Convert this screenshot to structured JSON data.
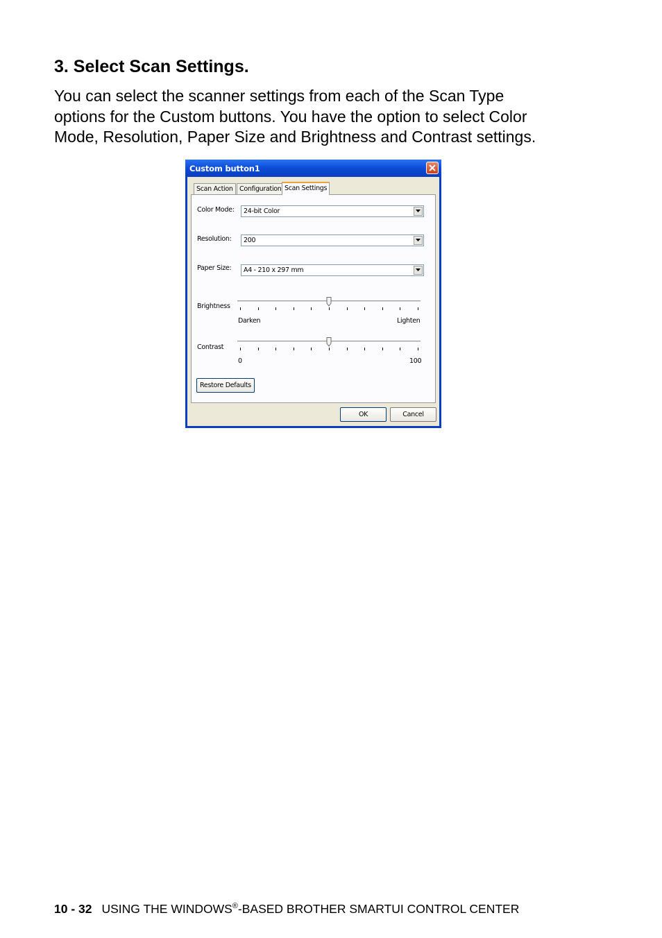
{
  "heading": "3. Select Scan Settings.",
  "intro_lines": [
    "You can select the scanner settings from each of the Scan Type",
    "options for the Custom buttons. You have the option to select Color",
    "Mode, Resolution, Paper Size and Brightness and Contrast settings."
  ],
  "dialog": {
    "title": "Custom button1",
    "tabs": [
      "Scan Action",
      "Configuration",
      "Scan Settings"
    ],
    "active_tab": "Scan Settings",
    "color_mode": {
      "label": "Color Mode:",
      "value": "24-bit Color"
    },
    "resolution": {
      "label": "Resolution:",
      "value": "200"
    },
    "paper_size": {
      "label": "Paper Size:",
      "value": "A4 - 210 x 297 mm"
    },
    "brightness": {
      "label": "Brightness",
      "min_label": "Darken",
      "max_label": "Lighten",
      "level": 0.5
    },
    "contrast": {
      "label": "Contrast",
      "min_label": "0",
      "max_label": "100",
      "level": 0.5
    },
    "restore_button": "Restore Defaults",
    "ok_button": "OK",
    "cancel_button": "Cancel"
  },
  "footer": {
    "page_number": "10 - 32",
    "text_before": "USING THE WINDOWS",
    "registered": "®",
    "text_after": "-BASED BROTHER SMARTUI CONTROL CENTER"
  }
}
